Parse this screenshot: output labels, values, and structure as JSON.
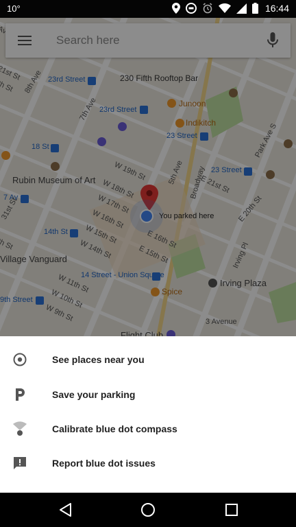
{
  "status_bar": {
    "temperature": "10°",
    "time": "16:44"
  },
  "search": {
    "placeholder": "Search here"
  },
  "map": {
    "labels": {
      "fifth_rooftop_bar": "230 Fifth Rooftop Bar",
      "junoon": "Junoon",
      "indikitch": "Indikitch",
      "rubin": "Rubin Museum of Art",
      "village_vanguard": "Village Vanguard",
      "spice": "Spice",
      "irving_plaza": "Irving Plaza",
      "flight_club": "Flight Club",
      "st23_station_left": "23rd Street",
      "st23_station_mid": "23rd Street",
      "st23_station_right": "23 Street",
      "st23_station_east": "23 Street",
      "st18_station": "18 St",
      "st14_station": "14th St",
      "union_square": "14 Street - Union Square",
      "st9_station": "9th Street",
      "av7_station": "7 Av",
      "seventh_ave": "7th Ave",
      "eighth_ave": "8th Ave",
      "fifth_ave": "5th Ave",
      "broadway": "Broadway",
      "park_ave_s": "Park Ave S",
      "irving_pl": "Irving Pl",
      "third_ave": "3 Avenue",
      "w19": "W 19th St",
      "w18": "W 18th St",
      "w17": "W 17th St",
      "w16": "W 16th St",
      "w15": "W 15th St",
      "w14": "W 14th St",
      "w11": "W 11th St",
      "w10": "W 10th St",
      "w9": "W 9th St",
      "e21": "E 21st St",
      "e20": "E 20th St",
      "e16": "E 16th St",
      "e15": "E 15th St",
      "st21": "21st St",
      "st31": "31st St",
      "th_st_left": "th St",
      "th_st_left2": "th St",
      "av_left": "Ave"
    },
    "parked_label": "You parked here"
  },
  "sheet": {
    "items": [
      {
        "label": "See places near you",
        "icon": "target-icon"
      },
      {
        "label": "Save your parking",
        "icon": "parking-icon"
      },
      {
        "label": "Calibrate blue dot compass",
        "icon": "compass-signal-icon"
      },
      {
        "label": "Report blue dot issues",
        "icon": "feedback-icon"
      }
    ]
  },
  "nav_bar": {
    "back_icon": "back-triangle-icon",
    "home_icon": "home-circle-icon",
    "recents_icon": "recents-square-icon"
  }
}
